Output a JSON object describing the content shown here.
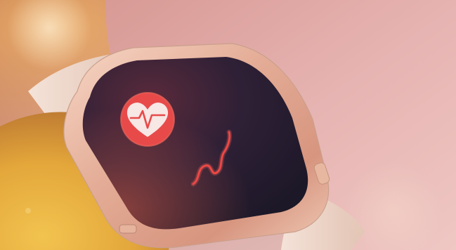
{
  "scene": {
    "subject": "smartwatch",
    "screen_icons": [
      "heart-rate-icon",
      "pulse-wave-icon"
    ]
  },
  "colors": {
    "accent_red": "#e84a4a",
    "wave_red": "#e83b3b",
    "screen_dark": "#2a1f3a",
    "case_rose_gold": "#e9b9a3",
    "strap_cream": "#efd9cc",
    "sleeve_yellow": "#e9b640",
    "skin_pink": "#d9a4a6",
    "backdrop_peach": "#c98a7a"
  }
}
